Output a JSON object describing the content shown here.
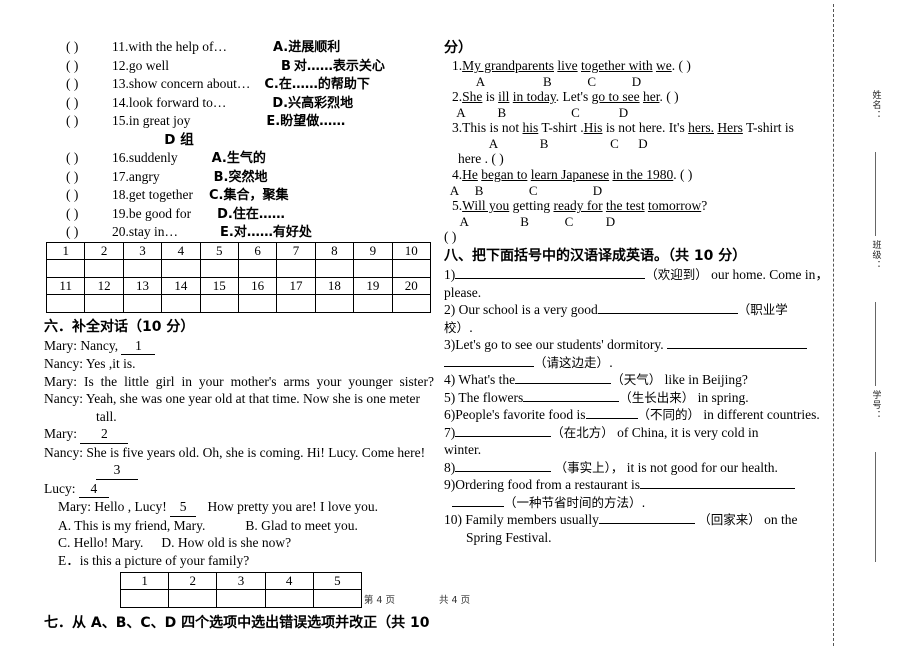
{
  "document": {
    "footer": {
      "page_current": "第 4 页",
      "page_total": "共 4 页"
    },
    "margin_labels": [
      "姓名：",
      "班级：",
      "学号："
    ]
  },
  "left_column": {
    "group_c_items": [
      {
        "paren": "(        )",
        "number": "11.",
        "english": "with the help of…",
        "letter": "A.",
        "chinese": "进展顺利"
      },
      {
        "paren": "(        )",
        "number": "12.",
        "english": "go well",
        "letter": "B",
        "chinese": "对……表示关心"
      },
      {
        "paren": "(        )",
        "number": "13.",
        "english": "show concern about…",
        "letter": "C.",
        "chinese": "在……的帮助下"
      },
      {
        "paren": "(        )",
        "number": "14.",
        "english": "look forward to…",
        "letter": "D.",
        "chinese": "兴高彩烈地"
      },
      {
        "paren": "(        )",
        "number": "15.",
        "english": "in great joy",
        "letter": "E.",
        "chinese": "盼望做……"
      }
    ],
    "group_d_title": "D 组",
    "group_d_items": [
      {
        "paren": "(        )",
        "number": "16.",
        "english": "suddenly",
        "letter": "A.",
        "chinese": "生气的"
      },
      {
        "paren": "(        )",
        "number": "17.",
        "english": "angry",
        "letter": "B.",
        "chinese": "突然地"
      },
      {
        "paren": "(        )",
        "number": "18.",
        "english": "get together",
        "letter": "C.",
        "chinese": "集合，聚集"
      },
      {
        "paren": "(        )",
        "number": "19.",
        "english": "be good for",
        "letter": "D.",
        "chinese": "住在……"
      },
      {
        "paren": "(        )",
        "number": "20.",
        "english": "stay in…",
        "letter": "E.",
        "chinese": "对……有好处"
      }
    ],
    "answer_table_20": {
      "row1_numbers": [
        "1",
        "2",
        "3",
        "4",
        "5",
        "6",
        "7",
        "8",
        "9",
        "10"
      ],
      "row2_numbers": [
        "11",
        "12",
        "13",
        "14",
        "15",
        "16",
        "17",
        "18",
        "19",
        "20"
      ]
    },
    "section_six": {
      "heading": "六．补全对话（10 分）",
      "lines": [
        {
          "speaker": "Mary:",
          "text": "Nancy,",
          "blank": "1",
          "type": "blank-after"
        },
        {
          "speaker": "Nancy:",
          "text": "Yes ,it is.",
          "type": "plain"
        },
        {
          "speaker": "Mary:",
          "text": "Is the little girl in your mother's arms your younger sister?",
          "type": "justify"
        },
        {
          "speaker": "Nancy:",
          "text": "Yeah, she was one year old at that time. Now she is one meter tall.",
          "type": "wrap"
        },
        {
          "speaker": "Mary:",
          "text": "",
          "blank": "2",
          "type": "blank-after"
        },
        {
          "speaker": "Nancy:",
          "text": "She is five years old. Oh, she is coming. Hi! Lucy. Come here!",
          "blank": "3",
          "type": "wrap-blank"
        },
        {
          "speaker": "Lucy:",
          "text": "",
          "blank": "4",
          "type": "blank-after"
        },
        {
          "speaker": "Mary:",
          "text": "Hello , Lucy!",
          "blank": "5",
          "tail": "How pretty you are! I love you.",
          "type": "blank-mid"
        }
      ],
      "options": [
        "A. This is my friend, Mary.",
        "B. Glad to meet you.",
        "C. Hello! Mary.",
        "D. How old is she now?",
        "E．is this a picture of your family?"
      ],
      "answer_table_5": [
        "1",
        "2",
        "3",
        "4",
        "5"
      ]
    },
    "section_seven_heading_part1": "七．从 A、B、C、D 四个选项中选出错误选项并改正（共 10"
  },
  "right_column": {
    "section_seven_heading_part2": "分）",
    "error_items": [
      {
        "number": "1.",
        "segments": [
          {
            "text": "My grandparents",
            "underline": true
          },
          {
            "text": " ",
            "underline": false
          },
          {
            "text": "live",
            "underline": true
          },
          {
            "text": " ",
            "underline": false
          },
          {
            "text": "together with",
            "underline": true
          },
          {
            "text": " ",
            "underline": false
          },
          {
            "text": "we",
            "underline": true
          },
          {
            "text": ". (                    )",
            "underline": false
          }
        ],
        "marks": "          A                  B           C           D"
      },
      {
        "number": "2.",
        "segments": [
          {
            "text": "She",
            "underline": true
          },
          {
            "text": " is ",
            "underline": false
          },
          {
            "text": "ill",
            "underline": true
          },
          {
            "text": " ",
            "underline": false
          },
          {
            "text": "in today",
            "underline": true
          },
          {
            "text": ". Let's ",
            "underline": false
          },
          {
            "text": "go to see",
            "underline": true
          },
          {
            "text": " ",
            "underline": false
          },
          {
            "text": "her",
            "underline": true
          },
          {
            "text": ". (                   )",
            "underline": false
          }
        ],
        "marks": "    A          B                    C            D"
      },
      {
        "number": "3.",
        "segments": [
          {
            "text": "This is not ",
            "underline": false
          },
          {
            "text": "his",
            "underline": true
          },
          {
            "text": " T-shirt .",
            "underline": false
          },
          {
            "text": "His",
            "underline": true
          },
          {
            "text": " is not here. It's ",
            "underline": false
          },
          {
            "text": "hers.",
            "underline": true
          },
          {
            "text": " ",
            "underline": false
          },
          {
            "text": "Hers",
            "underline": true
          },
          {
            "text": " T-shirt is",
            "underline": false
          }
        ],
        "marks": "              A             B                   C      D",
        "continuation": "here . (                              )"
      },
      {
        "number": "4.",
        "segments": [
          {
            "text": "He",
            "underline": true
          },
          {
            "text": " ",
            "underline": false
          },
          {
            "text": "began to",
            "underline": true
          },
          {
            "text": " ",
            "underline": false
          },
          {
            "text": "learn Japanese",
            "underline": true
          },
          {
            "text": " ",
            "underline": false
          },
          {
            "text": "in the 1980",
            "underline": true
          },
          {
            "text": ". (                   )",
            "underline": false
          }
        ],
        "marks": "  A     B              C                 D"
      },
      {
        "number": "5.",
        "segments": [
          {
            "text": "Will you",
            "underline": true
          },
          {
            "text": " getting ",
            "underline": false
          },
          {
            "text": "ready for",
            "underline": true
          },
          {
            "text": " ",
            "underline": false
          },
          {
            "text": "the test",
            "underline": true
          },
          {
            "text": "   ",
            "underline": false
          },
          {
            "text": "tomorrow",
            "underline": true
          },
          {
            "text": "?",
            "underline": false
          }
        ],
        "marks": "     A                B           C          D",
        "continuation": "   (                                  )"
      }
    ],
    "section_eight": {
      "heading": "八、把下面括号中的汉语译成英语。（共 10 分）",
      "items": [
        {
          "number": "1)",
          "pre": "",
          "blank": "xl",
          "hint": "（欢迎到）",
          "post": "our home. Come in，",
          "tail": "please."
        },
        {
          "number": "2)",
          "pre": "Our school is a very good",
          "blank": "l",
          "hint": "（职业学",
          "post": "",
          "tail": "校）."
        },
        {
          "number": "3)",
          "pre": "Let's go to see our students' dormitory.",
          "blank": "l",
          "hint": "",
          "post": "",
          "tail2": "（请这边走）."
        },
        {
          "number": "4)",
          "pre": "What's the",
          "blank": "m",
          "hint": "（天气）",
          "post": "like in Beijing?",
          "tail": ""
        },
        {
          "number": "5)",
          "pre": "The flowers",
          "blank": "m",
          "hint": "（生长出来）",
          "post": "in spring.",
          "tail": ""
        },
        {
          "number": "6)",
          "pre": "People's favorite food is",
          "blank": "s",
          "hint": "（不同的）",
          "post": "in different countries.",
          "tail": ""
        },
        {
          "number": "7)",
          "pre": "",
          "blank": "m",
          "hint": "（在北方）",
          "post": "of China, it is very cold in",
          "tail": "winter."
        },
        {
          "number": "8)",
          "pre": "",
          "blank": "m",
          "hint": "（事实上），",
          "post": "it is not good for our health.",
          "tail": ""
        },
        {
          "number": "9)",
          "pre": "Ordering food from a restaurant is",
          "blank": "xl",
          "hint": "",
          "post": "",
          "tail2": "（一种节省时间的方法）."
        },
        {
          "number": "10)",
          "pre": "Family members usually",
          "blank": "m",
          "hint": "（回家来）",
          "post": "on the",
          "tail": "Spring Festival."
        }
      ]
    }
  }
}
